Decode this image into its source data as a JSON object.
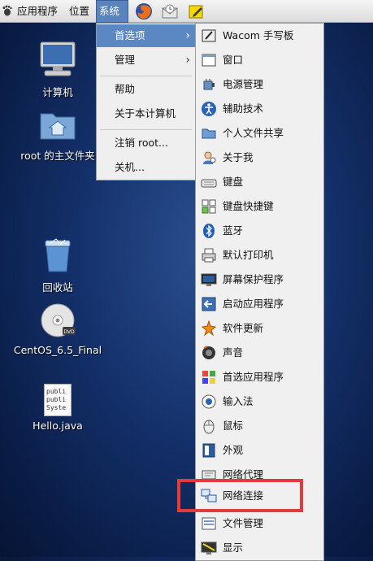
{
  "panel": {
    "menus": [
      "应用程序",
      "位置",
      "系统"
    ]
  },
  "desktop": {
    "icons": [
      {
        "label": "计算机",
        "icon": "computer-icon"
      },
      {
        "label": "root 的主文件夹",
        "icon": "home-folder-icon"
      },
      {
        "label": "回收站",
        "icon": "trash-icon"
      },
      {
        "label": "CentOS_6.5_Final",
        "icon": "dvd-icon"
      },
      {
        "label": "Hello.java",
        "icon": "text-file-icon",
        "preview_lines": [
          "publi",
          "publi",
          "Syste"
        ]
      }
    ]
  },
  "system_menu": {
    "items": [
      "首选项",
      "管理",
      "帮助",
      "关于本计算机",
      "注销 root...",
      "关机..."
    ],
    "highlighted": "首选项"
  },
  "preferences_menu": {
    "items": [
      {
        "label": "Wacom 手写板",
        "icon": "tablet-icon"
      },
      {
        "label": "窗口",
        "icon": "window-icon"
      },
      {
        "label": "电源管理",
        "icon": "power-icon"
      },
      {
        "label": "辅助技术",
        "icon": "accessibility-icon"
      },
      {
        "label": "个人文件共享",
        "icon": "folder-share-icon"
      },
      {
        "label": "关于我",
        "icon": "about-me-icon"
      },
      {
        "label": "键盘",
        "icon": "keyboard-icon"
      },
      {
        "label": "键盘快捷键",
        "icon": "shortcuts-icon"
      },
      {
        "label": "蓝牙",
        "icon": "bluetooth-icon"
      },
      {
        "label": "默认打印机",
        "icon": "printer-icon"
      },
      {
        "label": "屏幕保护程序",
        "icon": "screensaver-icon"
      },
      {
        "label": "启动应用程序",
        "icon": "startup-icon"
      },
      {
        "label": "软件更新",
        "icon": "software-update-icon"
      },
      {
        "label": "声音",
        "icon": "sound-icon"
      },
      {
        "label": "首选应用程序",
        "icon": "preferred-apps-icon"
      },
      {
        "label": "输入法",
        "icon": "input-method-icon"
      },
      {
        "label": "鼠标",
        "icon": "mouse-icon"
      },
      {
        "label": "外观",
        "icon": "appearance-icon"
      },
      {
        "label": "网络代理",
        "icon": "network-proxy-icon"
      },
      {
        "label": "网络连接",
        "icon": "network-connections-icon"
      },
      {
        "label": "文件管理",
        "icon": "file-management-icon"
      },
      {
        "label": "显示",
        "icon": "display-icon"
      }
    ]
  },
  "annotation": {
    "highlight_color": "#e23b3b",
    "target": "网络连接"
  }
}
